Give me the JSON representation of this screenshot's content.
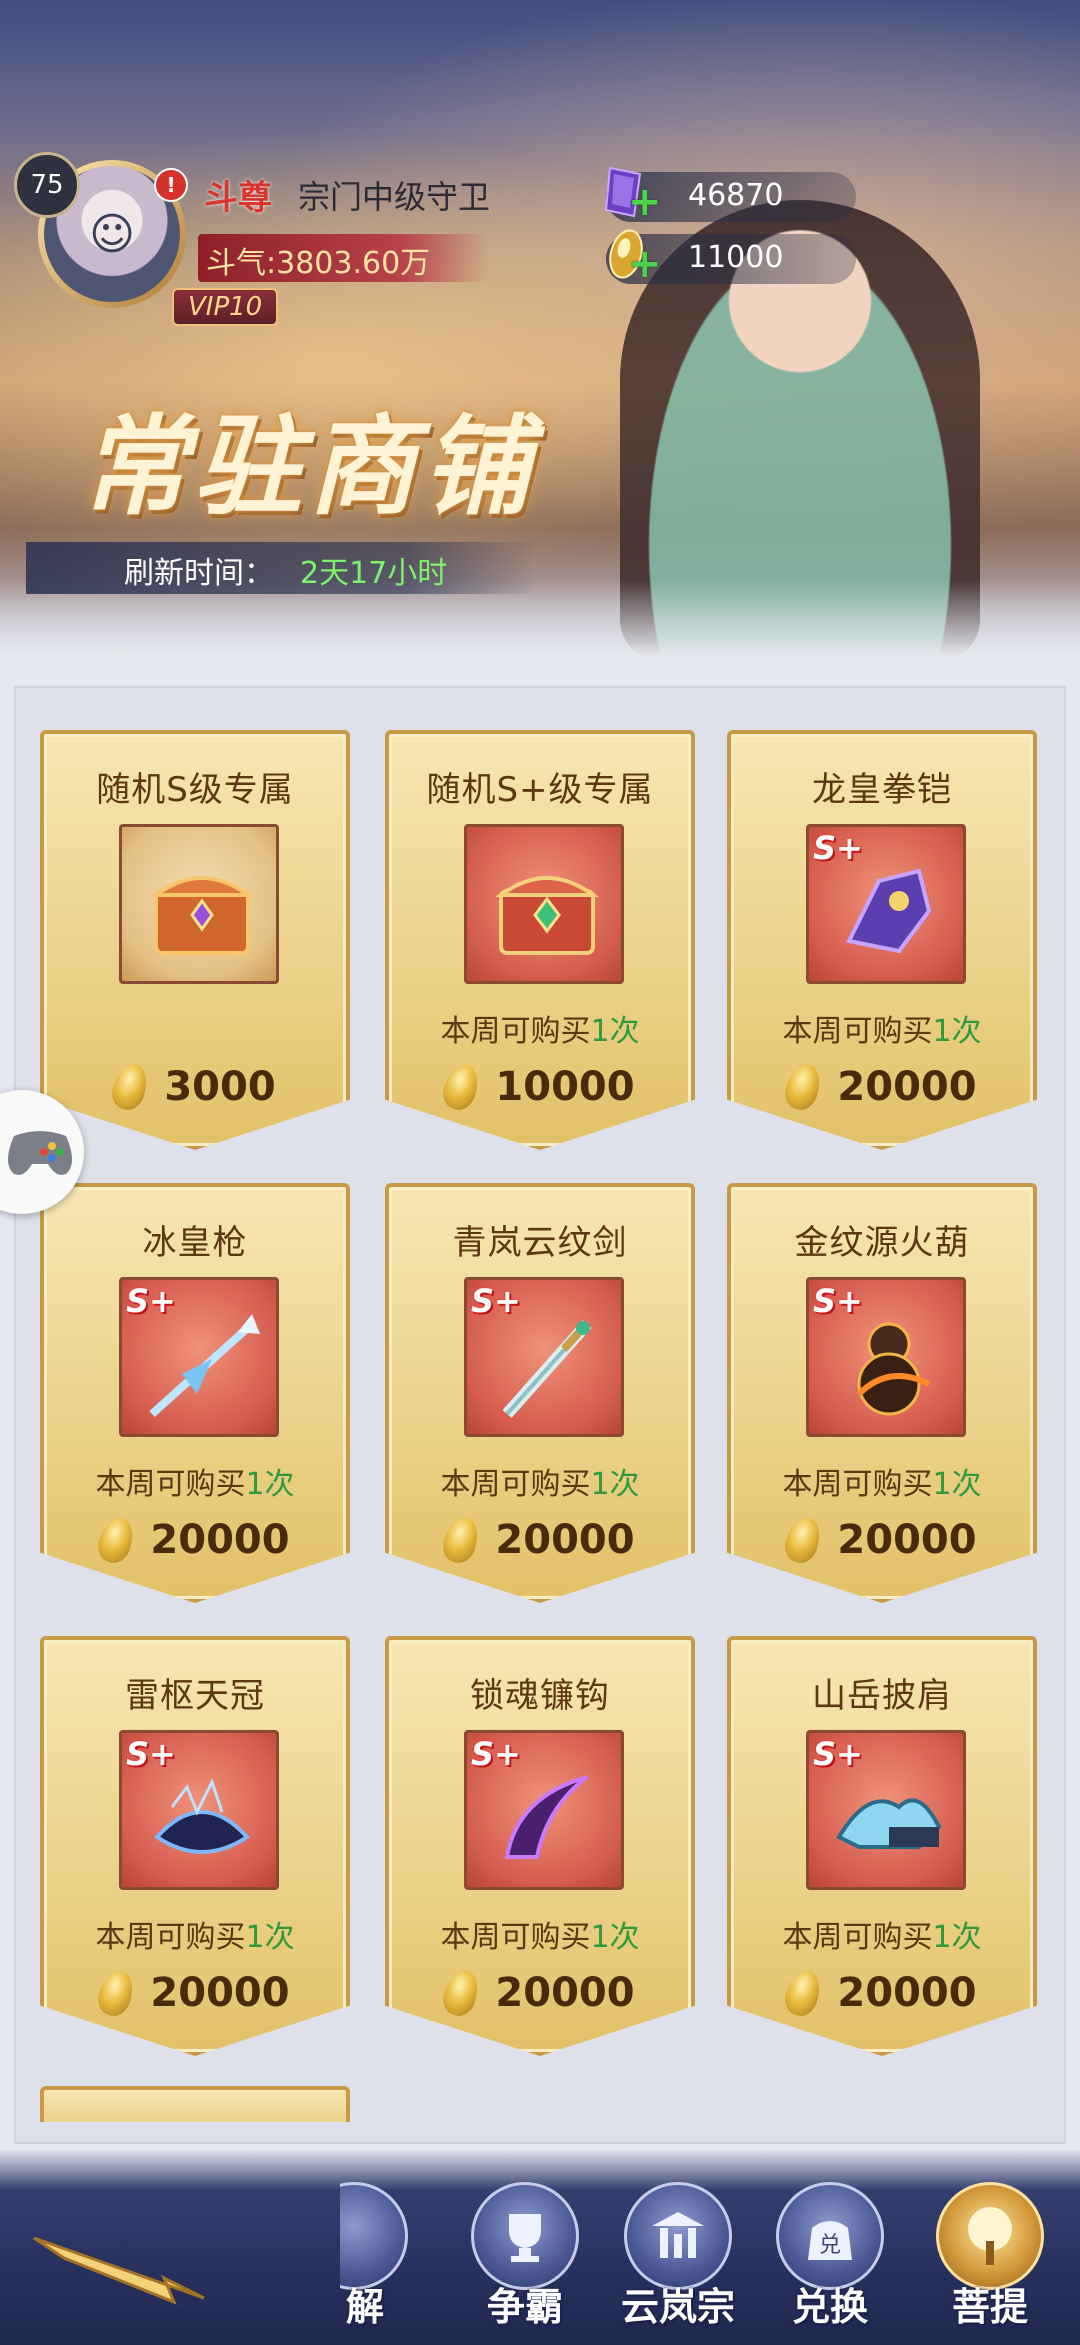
{
  "player": {
    "level": "75",
    "rank": "斗尊",
    "name": "宗门中级守卫",
    "power": "斗气:3803.60万",
    "vip": "VIP10",
    "alert": "!"
  },
  "currencies": [
    {
      "icon": "purple-crystal-icon",
      "value": "46870",
      "color": "#7b4fd0"
    },
    {
      "icon": "gold-crystal-icon",
      "value": "11000",
      "color": "#e3b23c"
    }
  ],
  "shop": {
    "title": "常驻商铺",
    "refresh_label": "刷新时间：",
    "refresh_value": "2天17小时"
  },
  "items": [
    {
      "name": "随机S级专属",
      "limit": null,
      "price": "3000",
      "badge": "",
      "icon": "treasure-chest-icon"
    },
    {
      "name": "随机S+级专属",
      "limit_prefix": "本周可购买",
      "limit_count": "1次",
      "price": "10000",
      "badge": "",
      "icon": "treasure-chest-icon"
    },
    {
      "name": "龙皇拳铠",
      "limit_prefix": "本周可购买",
      "limit_count": "1次",
      "price": "20000",
      "badge": "S+",
      "icon": "gauntlet-icon"
    },
    {
      "name": "冰皇枪",
      "limit_prefix": "本周可购买",
      "limit_count": "1次",
      "price": "20000",
      "badge": "S+",
      "icon": "spear-icon"
    },
    {
      "name": "青岚云纹剑",
      "limit_prefix": "本周可购买",
      "limit_count": "1次",
      "price": "20000",
      "badge": "S+",
      "icon": "sword-icon"
    },
    {
      "name": "金纹源火葫",
      "limit_prefix": "本周可购买",
      "limit_count": "1次",
      "price": "20000",
      "badge": "S+",
      "icon": "gourd-icon"
    },
    {
      "name": "雷枢天冠",
      "limit_prefix": "本周可购买",
      "limit_count": "1次",
      "price": "20000",
      "badge": "S+",
      "icon": "crown-icon"
    },
    {
      "name": "锁魂镰钩",
      "limit_prefix": "本周可购买",
      "limit_count": "1次",
      "price": "20000",
      "badge": "S+",
      "icon": "sickle-icon"
    },
    {
      "name": "山岳披肩",
      "limit_prefix": "本周可购买",
      "limit_count": "1次",
      "price": "20000",
      "badge": "S+",
      "icon": "shoulder-guard-icon"
    }
  ],
  "nav": [
    {
      "label": "解",
      "icon": "partial-icon"
    },
    {
      "label": "争霸",
      "icon": "trophy-icon"
    },
    {
      "label": "云岚宗",
      "icon": "sect-gate-icon"
    },
    {
      "label": "兑换",
      "icon": "exchange-bag-icon",
      "badge": "兑"
    },
    {
      "label": "菩提",
      "icon": "bodhi-tree-icon"
    }
  ],
  "colors": {
    "accent_green": "#2f9a3d",
    "rank_red": "#d8352c",
    "card_gold": "#ecd38b",
    "item_bg": "#d65d4f"
  }
}
